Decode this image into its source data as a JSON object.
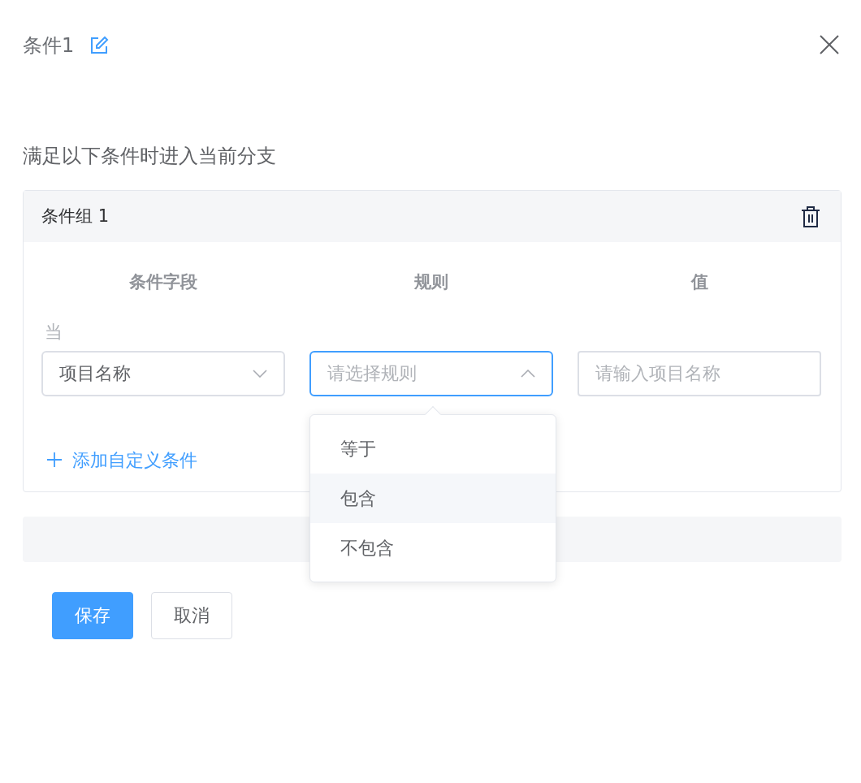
{
  "dialog": {
    "title": "条件1",
    "subtitle": "满足以下条件时进入当前分支"
  },
  "condition_group": {
    "title": "条件组 1",
    "columns": [
      "条件字段",
      "规则",
      "值"
    ],
    "row_prefix": "当",
    "field_select": {
      "value": "项目名称",
      "expanded": false
    },
    "rule_select": {
      "placeholder": "请选择规则",
      "expanded": true,
      "options": [
        {
          "label": "等于",
          "highlighted": false
        },
        {
          "label": "包含",
          "highlighted": true
        },
        {
          "label": "不包含",
          "highlighted": false
        }
      ]
    },
    "value_input": {
      "placeholder": "请输入项目名称"
    },
    "add_condition": "添加自定义条件"
  },
  "buttons": [
    {
      "label": "保存",
      "kind": "primary"
    },
    {
      "label": "取消",
      "kind": "default"
    }
  ]
}
